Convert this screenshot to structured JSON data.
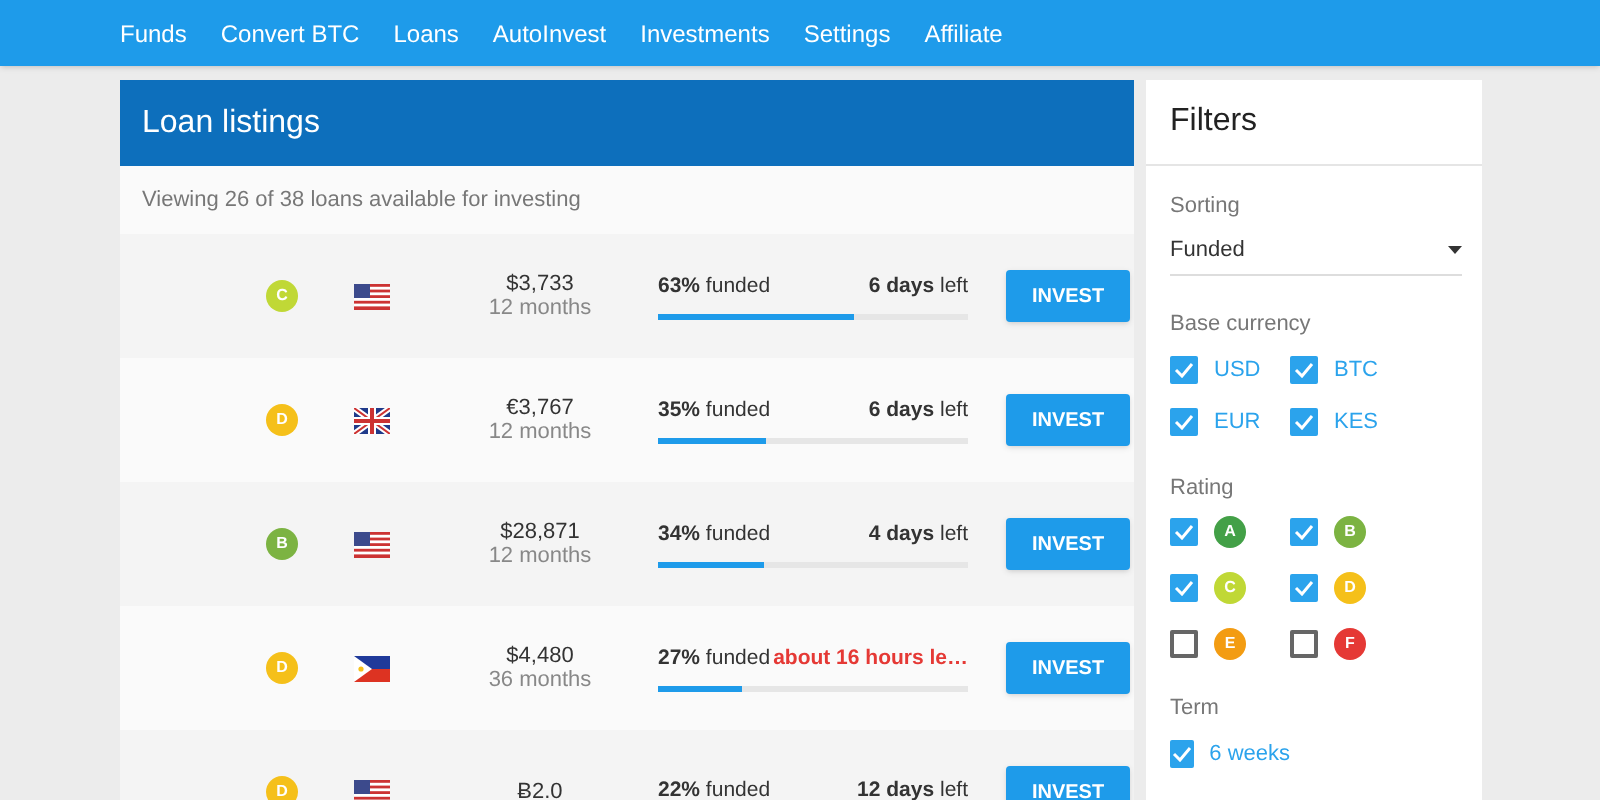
{
  "nav": {
    "items": [
      "Funds",
      "Convert BTC",
      "Loans",
      "AutoInvest",
      "Investments",
      "Settings",
      "Affiliate"
    ]
  },
  "listings": {
    "title": "Loan listings",
    "summary": "Viewing 26 of 38 loans available for investing",
    "rows": [
      {
        "rating": "C",
        "color": "#c0d836",
        "flag": {
          "kind": "us"
        },
        "amount": "$3,733",
        "term": "12 months",
        "funded": "**63%** funded",
        "level": 0.63,
        "time_left": "**6 days** left",
        "urgent": false,
        "button": "INVEST"
      },
      {
        "rating": "D",
        "color": "#f5c01a",
        "flag": {
          "kind": "gb"
        },
        "amount": "€3,767",
        "term": "12 months",
        "funded": "**35%** funded",
        "level": 0.35,
        "time_left": "**6 days** left",
        "urgent": false,
        "button": "INVEST"
      },
      {
        "rating": "B",
        "color": "#7cb342",
        "flag": {
          "kind": "us"
        },
        "amount": "$28,871",
        "term": "12 months",
        "funded": "**34%** funded",
        "level": 0.34,
        "time_left": "**4 days** left",
        "urgent": false,
        "button": "INVEST"
      },
      {
        "rating": "D",
        "color": "#f5c01a",
        "flag": {
          "kind": "ph"
        },
        "amount": "$4,480",
        "term": "36 months",
        "funded": "**27%** funded",
        "level": 0.27,
        "time_left": "about 16 hours le…",
        "urgent": true,
        "button": "INVEST"
      },
      {
        "rating": "D",
        "color": "#f5c01a",
        "flag": {
          "kind": "us"
        },
        "amount": "Ƀ2.0",
        "funded": "**22%** funded",
        "time_left": "**12 days** left",
        "urgent": false,
        "button": "INVEST"
      }
    ]
  },
  "filters": {
    "title": "Filters",
    "sorting": {
      "label": "Sorting",
      "value": "Funded"
    },
    "currency": {
      "label": "Base currency",
      "options": [
        {
          "label": "USD",
          "checked": true
        },
        {
          "label": "BTC",
          "checked": true
        },
        {
          "label": "EUR",
          "checked": true
        },
        {
          "label": "KES",
          "checked": true
        }
      ]
    },
    "rating": {
      "label": "Rating",
      "options": [
        {
          "label": "A",
          "color": "#43a047",
          "checked": true
        },
        {
          "label": "B",
          "color": "#7cb342",
          "checked": true
        },
        {
          "label": "C",
          "color": "#c0d836",
          "checked": true
        },
        {
          "label": "D",
          "color": "#f5c01a",
          "checked": true
        },
        {
          "label": "E",
          "color": "#f39c12",
          "checked": false
        },
        {
          "label": "F",
          "color": "#e53935",
          "checked": false
        }
      ]
    },
    "term": {
      "label": "Term",
      "options": [
        {
          "label": "6 weeks",
          "checked": true
        }
      ]
    }
  }
}
